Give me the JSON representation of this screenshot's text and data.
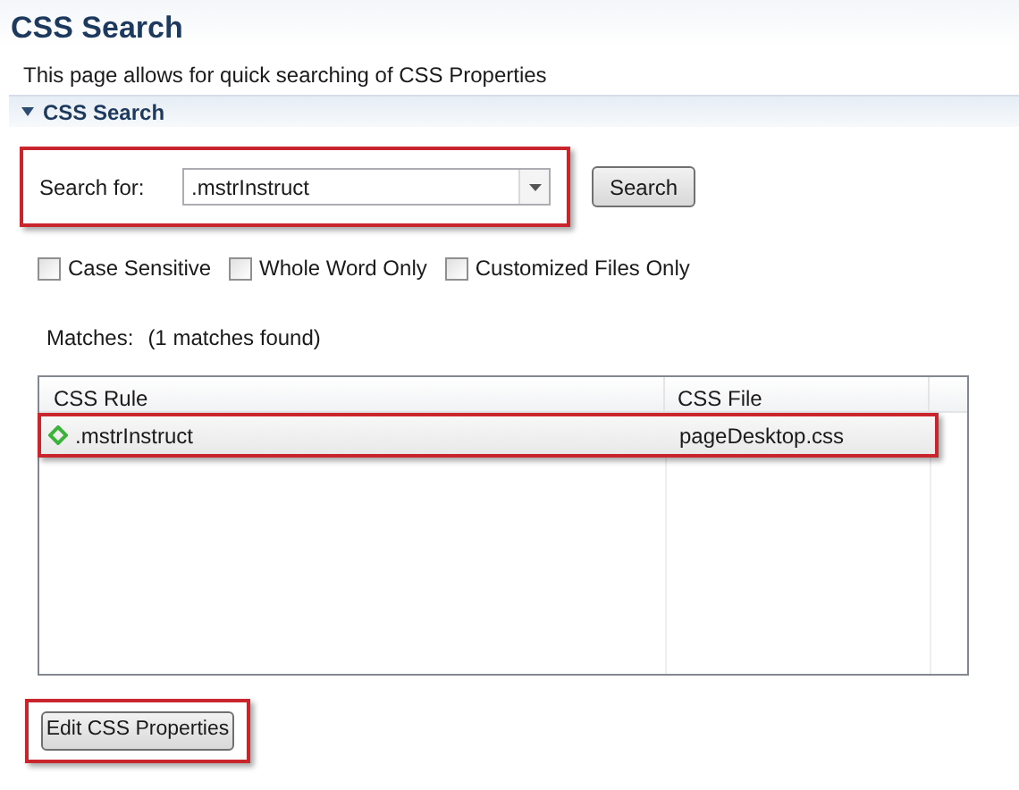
{
  "page": {
    "title": "CSS Search",
    "description": "This page allows for quick searching of CSS Properties"
  },
  "section": {
    "title": "CSS Search",
    "expanded": true
  },
  "search": {
    "label": "Search for:",
    "value": ".mstrInstruct",
    "button": "Search",
    "highlighted": true
  },
  "options": [
    {
      "label": "Case Sensitive",
      "checked": false
    },
    {
      "label": "Whole Word Only",
      "checked": false
    },
    {
      "label": "Customized Files Only",
      "checked": false
    }
  ],
  "matches": {
    "label": "Matches:",
    "count": "(1 matches found)"
  },
  "table": {
    "columns": [
      "CSS Rule",
      "CSS File"
    ],
    "rows": [
      {
        "rule": ".mstrInstruct",
        "file": "pageDesktop.css",
        "highlighted": true
      }
    ]
  },
  "edit_button": {
    "label": "Edit CSS Properties",
    "highlighted": true
  }
}
